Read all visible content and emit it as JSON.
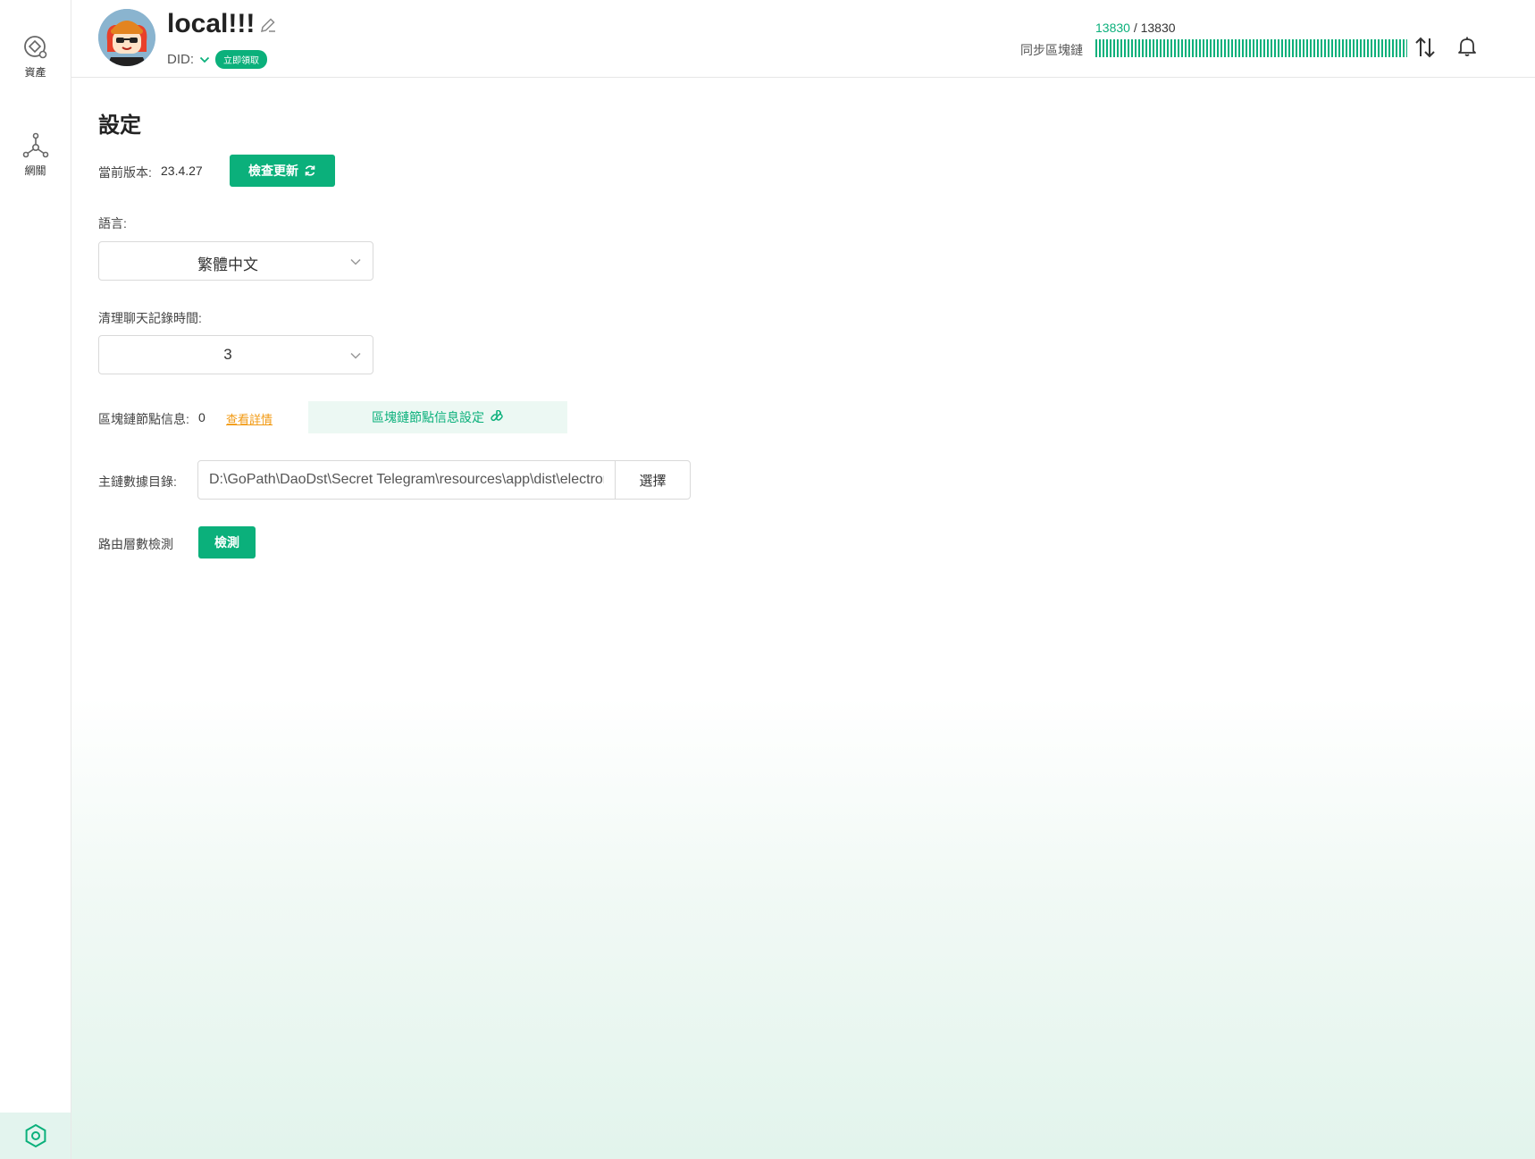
{
  "sidebar": {
    "items": [
      {
        "label": "資產",
        "icon": "assets-icon"
      },
      {
        "label": "網關",
        "icon": "network-icon"
      }
    ],
    "bottom_icon": "settings-hexagon-icon"
  },
  "header": {
    "username": "local!!!",
    "did_label": "DID:",
    "badge": "立即領取",
    "sync": {
      "label": "同步區塊鏈",
      "current": "13830",
      "separator": "/",
      "total": "13830",
      "progress": 1.0
    }
  },
  "settings": {
    "title": "設定",
    "version_label": "當前版本:",
    "version_value": "23.4.27",
    "check_update": "檢查更新",
    "language_label": "語言:",
    "language_value": "繁體中文",
    "clean_label": "清理聊天記錄時間:",
    "clean_value": "3",
    "node_label": "區塊鏈節點信息:",
    "node_value": "0",
    "node_details": "查看詳情",
    "node_settings": "區塊鏈節點信息設定",
    "dir_label": "主鏈數據目錄:",
    "dir_value": "D:\\GoPath\\DaoDst\\Secret Telegram\\resources\\app\\dist\\electron",
    "dir_button": "選擇",
    "route_label": "路由層數檢測",
    "route_button": "檢測"
  },
  "colors": {
    "accent": "#0bb07b",
    "link": "#f29a13"
  }
}
